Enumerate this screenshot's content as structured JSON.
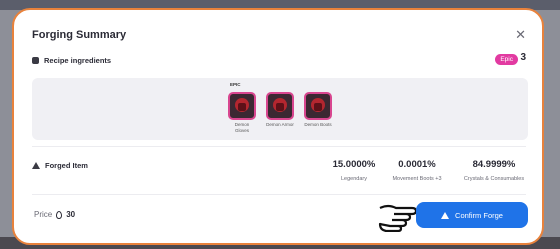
{
  "modal": {
    "title": "Forging Summary",
    "close_icon": "close-icon"
  },
  "recipe": {
    "label": "Recipe ingredients",
    "rarity_badge": "Epic",
    "count": "3",
    "tier_label": "EPIC",
    "items": [
      {
        "name": "Demon Gloves"
      },
      {
        "name": "Demon Armor"
      },
      {
        "name": "Demon Boots"
      }
    ]
  },
  "forged": {
    "label": "Forged Item",
    "stats": [
      {
        "value": "15.0000%",
        "label": "Legendary"
      },
      {
        "value": "0.0001%",
        "label": "Movement Boots +3"
      },
      {
        "value": "84.9999%",
        "label": "Crystals & Consumables"
      }
    ]
  },
  "footer": {
    "price_label": "Price",
    "price_value": "30",
    "confirm_label": "Confirm Forge"
  },
  "colors": {
    "accent": "#1f73e8",
    "epic": "#e23aa1",
    "modal_border": "#e8823c"
  }
}
